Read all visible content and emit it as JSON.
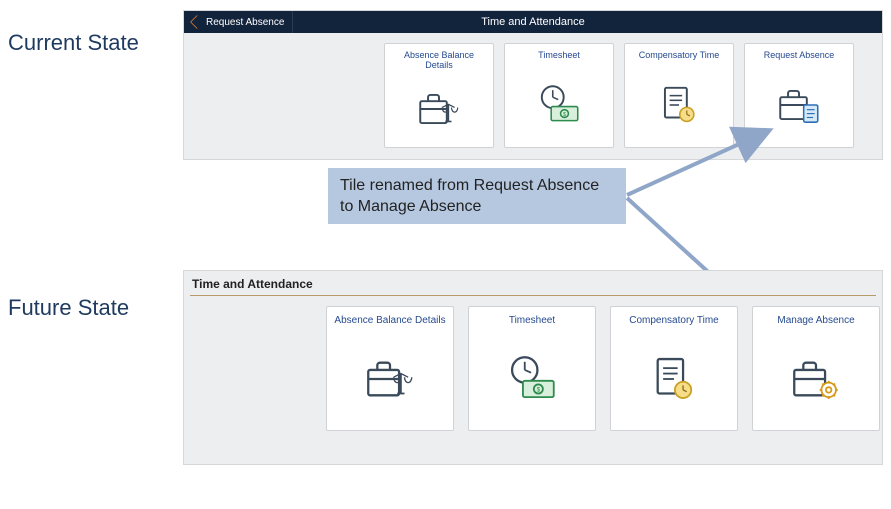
{
  "labels": {
    "current": "Current State",
    "future": "Future State"
  },
  "current": {
    "topbar_back": "Request Absence",
    "topbar_title": "Time and Attendance",
    "tiles": [
      {
        "title": "Absence Balance Details"
      },
      {
        "title": "Timesheet"
      },
      {
        "title": "Compensatory Time"
      },
      {
        "title": "Request Absence"
      }
    ]
  },
  "annotation": "Tile renamed from Request Absence to Manage Absence",
  "future": {
    "header": "Time and Attendance",
    "tiles": [
      {
        "title": "Absence Balance Details"
      },
      {
        "title": "Timesheet"
      },
      {
        "title": "Compensatory Time"
      },
      {
        "title": "Manage Absence"
      }
    ]
  }
}
